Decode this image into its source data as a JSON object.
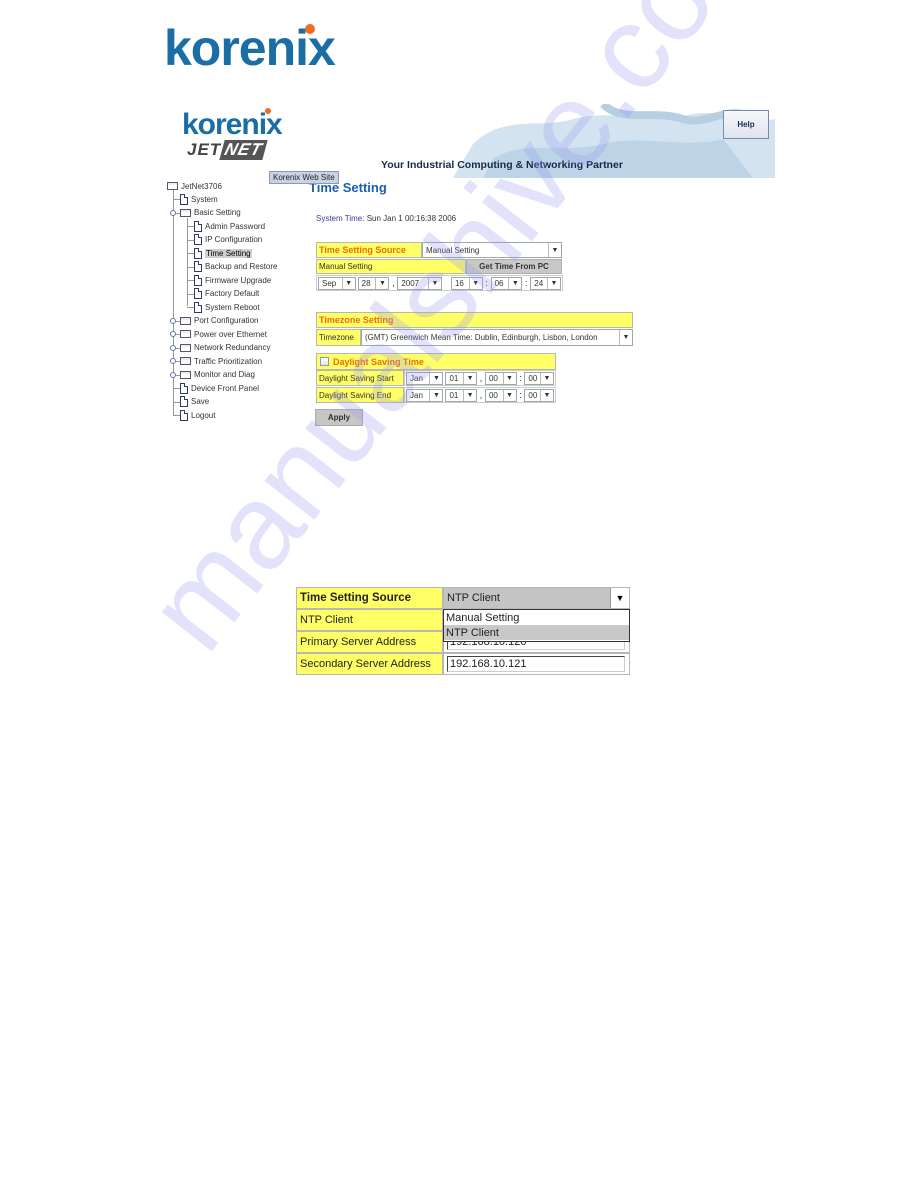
{
  "document": {
    "logo_text": "korenix",
    "watermark": "manualshive.com"
  },
  "screenshot1": {
    "banner": {
      "brand": "korenix",
      "product_prefix": "JET",
      "product_suffix": "NET",
      "tagline": "Your Industrial Computing & Networking Partner",
      "help_label": "Help",
      "tooltip": "Korenix Web Site"
    },
    "tree": {
      "root": "JetNet3706",
      "items": [
        {
          "label": "System",
          "type": "page",
          "level": 1
        },
        {
          "label": "Basic Setting",
          "type": "folder",
          "level": 1,
          "expanded": true
        },
        {
          "label": "Admin Password",
          "type": "page",
          "level": 2
        },
        {
          "label": "IP Configuration",
          "type": "page",
          "level": 2
        },
        {
          "label": "Time Setting",
          "type": "page",
          "level": 2,
          "selected": true
        },
        {
          "label": "Backup and Restore",
          "type": "page",
          "level": 2
        },
        {
          "label": "Firmware Upgrade",
          "type": "page",
          "level": 2
        },
        {
          "label": "Factory Default",
          "type": "page",
          "level": 2
        },
        {
          "label": "System Reboot",
          "type": "page",
          "level": 2
        },
        {
          "label": "Port Configuration",
          "type": "folder",
          "level": 1
        },
        {
          "label": "Power over Ethernet",
          "type": "folder",
          "level": 1
        },
        {
          "label": "Network Redundancy",
          "type": "folder",
          "level": 1
        },
        {
          "label": "Traffic Prioritization",
          "type": "folder",
          "level": 1
        },
        {
          "label": "Monitor and Diag",
          "type": "folder",
          "level": 1
        },
        {
          "label": "Device Front Panel",
          "type": "page",
          "level": 1
        },
        {
          "label": "Save",
          "type": "page",
          "level": 1
        },
        {
          "label": "Logout",
          "type": "page",
          "level": 1
        }
      ]
    },
    "page_title": "Time Setting",
    "system_time_label": "System Time:",
    "system_time_value": "Sun Jan 1 00:16:38 2006",
    "time_source": {
      "label": "Time Setting Source",
      "value": "Manual Setting"
    },
    "manual_setting": {
      "label": "Manual Setting",
      "get_time_button": "Get Time From PC",
      "month": "Sep",
      "day": "28",
      "year": "2007",
      "hour": "16",
      "minute": "06",
      "second": "24",
      "sep_comma": ",",
      "sep_colon": ":"
    },
    "timezone": {
      "header": "Timezone Setting",
      "label": "Timezone",
      "value": "(GMT) Greenwich Mean Time: Dublin, Edinburgh, Lisbon, London"
    },
    "dst": {
      "header": "Daylight Saving Time",
      "checked": false,
      "start": {
        "label": "Daylight Saving Start",
        "month": "Jan",
        "day": "01",
        "hour": "00",
        "minute": "00"
      },
      "end": {
        "label": "Daylight Saving End",
        "month": "Jan",
        "day": "01",
        "hour": "00",
        "minute": "00"
      }
    },
    "apply_label": "Apply",
    "arrow": "▼"
  },
  "screenshot2": {
    "time_source_label": "Time Setting Source",
    "time_source_value": "NTP Client",
    "options": [
      "Manual Setting",
      "NTP Client"
    ],
    "highlighted_option": "NTP Client",
    "ntp_client_label": "NTP Client",
    "primary_label": "Primary Server Address",
    "primary_value": "192.168.10.120",
    "secondary_label": "Secondary Server Address",
    "secondary_value": "192.168.10.121",
    "arrow": "▼"
  }
}
